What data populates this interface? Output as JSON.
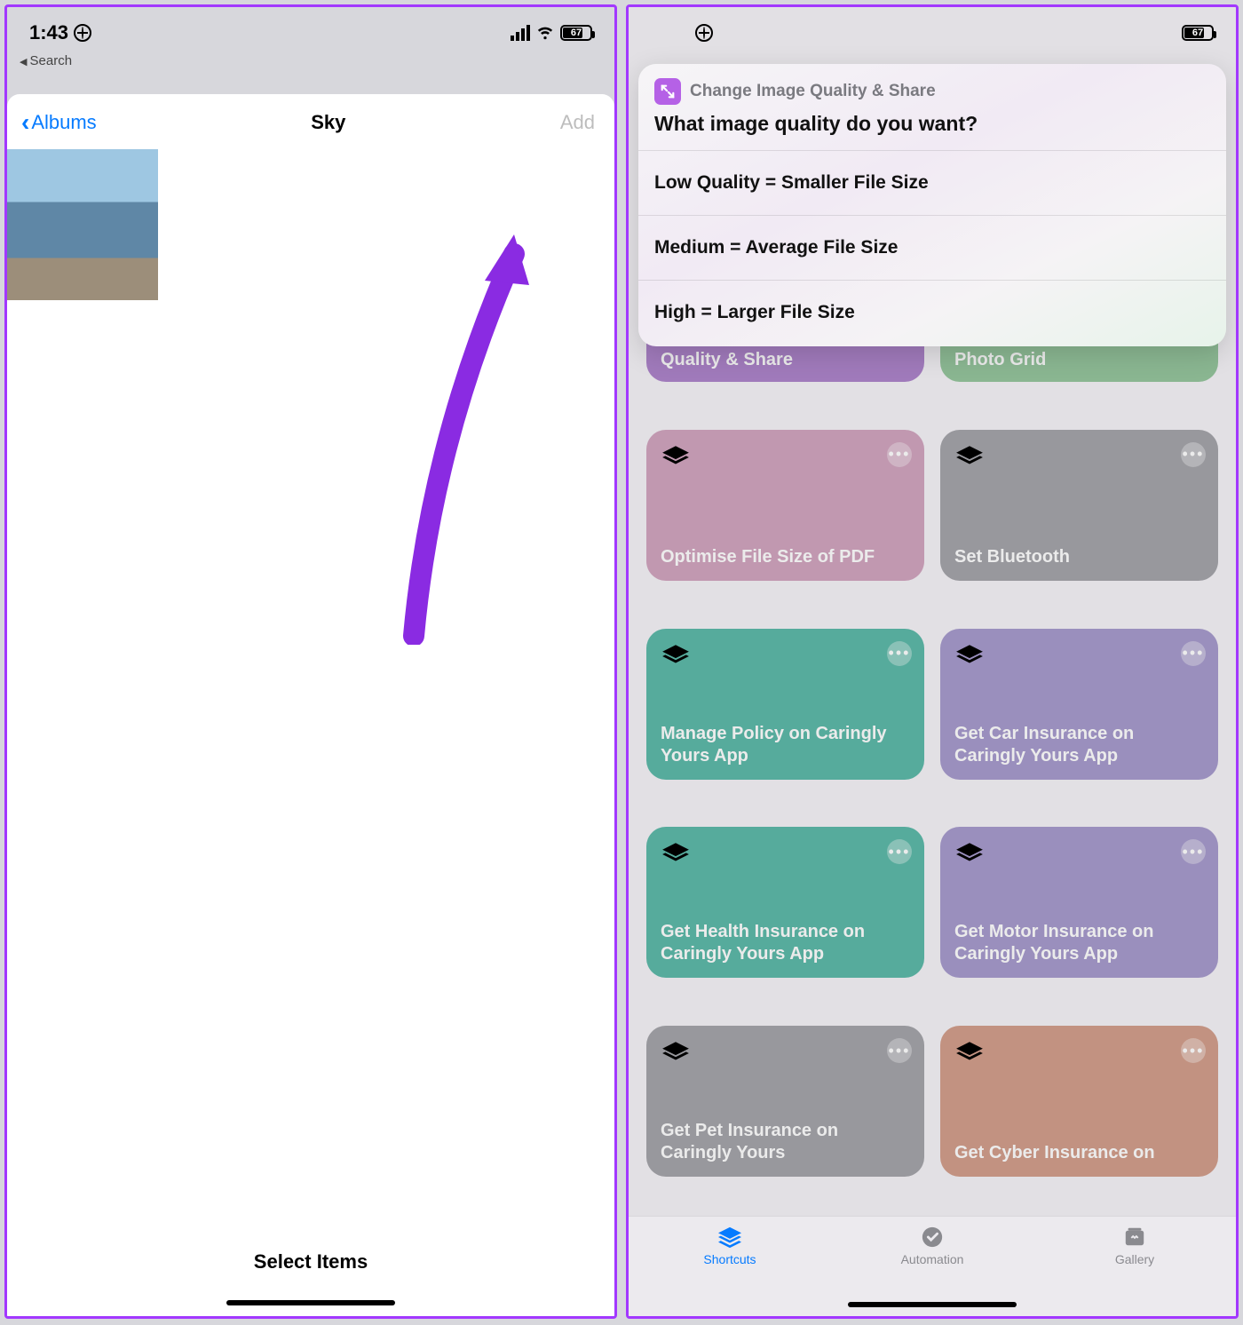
{
  "status": {
    "time": "1:43",
    "back_app": "Search",
    "battery_pct": "67"
  },
  "left": {
    "back_label": "Albums",
    "title": "Sky",
    "add_label": "Add",
    "footer": "Select Items"
  },
  "right": {
    "sheet": {
      "app_name": "Change Image Quality & Share",
      "question": "What image quality do you want?",
      "options": [
        "Low Quality = Smaller File Size",
        "Medium = Average File Size",
        "High = Larger File Size"
      ]
    },
    "cards": [
      {
        "label": "Quality & Share",
        "color": "c-purple",
        "partial": true
      },
      {
        "label": "Photo Grid",
        "color": "c-green",
        "partial": true
      },
      {
        "label": "Optimise File Size of PDF",
        "color": "c-pink"
      },
      {
        "label": "Set Bluetooth",
        "color": "c-gray"
      },
      {
        "label": "Manage Policy on Caringly Yours App",
        "color": "c-teal"
      },
      {
        "label": "Get Car Insurance on Caringly Yours App",
        "color": "c-lav"
      },
      {
        "label": "Get Health Insurance on Caringly Yours App",
        "color": "c-teal"
      },
      {
        "label": "Get Motor Insurance on Caringly Yours App",
        "color": "c-lav"
      },
      {
        "label": "Get Pet Insurance on Caringly Yours",
        "color": "c-gray"
      },
      {
        "label": "Get Cyber Insurance on",
        "color": "c-orange"
      }
    ],
    "tabs": {
      "shortcuts": "Shortcuts",
      "automation": "Automation",
      "gallery": "Gallery"
    }
  }
}
